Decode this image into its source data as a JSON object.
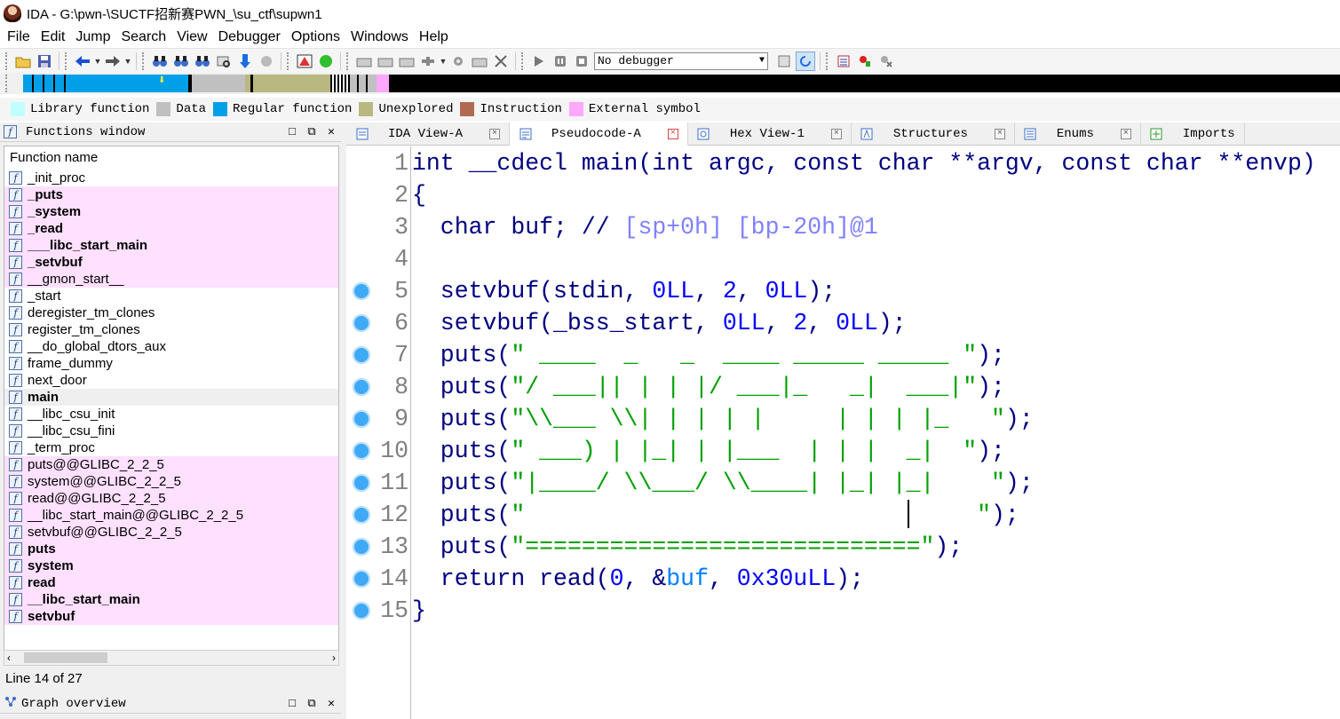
{
  "window": {
    "title": "IDA - G:\\pwn-\\SUCTF招新赛PWN_\\su_ctf\\supwn1"
  },
  "menu": [
    "File",
    "Edit",
    "Jump",
    "Search",
    "View",
    "Debugger",
    "Options",
    "Windows",
    "Help"
  ],
  "toolbar": {
    "debugger_select": "No debugger"
  },
  "legend": [
    {
      "label": "Library function",
      "color": "#c0ffff"
    },
    {
      "label": "Data",
      "color": "#c0c0c0"
    },
    {
      "label": "Regular function",
      "color": "#00a0e8"
    },
    {
      "label": "Unexplored",
      "color": "#b8b880"
    },
    {
      "label": "Instruction",
      "color": "#b06a50"
    },
    {
      "label": "External symbol",
      "color": "#ffa8ff"
    }
  ],
  "functions_window": {
    "title": "Functions window",
    "column_header": "Function name",
    "items": [
      {
        "name": "_init_proc",
        "style": "normal"
      },
      {
        "name": "_puts",
        "style": "lib-bold"
      },
      {
        "name": "_system",
        "style": "lib-bold"
      },
      {
        "name": "_read",
        "style": "lib-bold"
      },
      {
        "name": "___libc_start_main",
        "style": "lib-bold"
      },
      {
        "name": "_setvbuf",
        "style": "lib-bold"
      },
      {
        "name": "__gmon_start__",
        "style": "lib"
      },
      {
        "name": "_start",
        "style": "normal"
      },
      {
        "name": "deregister_tm_clones",
        "style": "normal"
      },
      {
        "name": "register_tm_clones",
        "style": "normal"
      },
      {
        "name": "__do_global_dtors_aux",
        "style": "normal"
      },
      {
        "name": "frame_dummy",
        "style": "normal"
      },
      {
        "name": "next_door",
        "style": "normal"
      },
      {
        "name": "main",
        "style": "selected-bold"
      },
      {
        "name": "__libc_csu_init",
        "style": "normal"
      },
      {
        "name": "__libc_csu_fini",
        "style": "normal"
      },
      {
        "name": "_term_proc",
        "style": "normal"
      },
      {
        "name": "puts@@GLIBC_2_2_5",
        "style": "lib"
      },
      {
        "name": "system@@GLIBC_2_2_5",
        "style": "lib"
      },
      {
        "name": "read@@GLIBC_2_2_5",
        "style": "lib"
      },
      {
        "name": "__libc_start_main@@GLIBC_2_2_5",
        "style": "lib"
      },
      {
        "name": "setvbuf@@GLIBC_2_2_5",
        "style": "lib"
      },
      {
        "name": "puts",
        "style": "lib-bold"
      },
      {
        "name": "system",
        "style": "lib-bold"
      },
      {
        "name": "read",
        "style": "lib-bold"
      },
      {
        "name": "__libc_start_main",
        "style": "lib-bold"
      },
      {
        "name": "setvbuf",
        "style": "lib-bold"
      }
    ],
    "status": "Line 14 of 27"
  },
  "graph_overview": {
    "title": "Graph overview"
  },
  "tabs": [
    {
      "label": "IDA View-A",
      "active": false
    },
    {
      "label": "Pseudocode-A",
      "active": true
    },
    {
      "label": "Hex View-1",
      "active": false
    },
    {
      "label": "Structures",
      "active": false
    },
    {
      "label": "Enums",
      "active": false
    },
    {
      "label": "Imports",
      "active": false
    }
  ],
  "code": {
    "lines": [
      {
        "n": "1",
        "bp": false,
        "parts": [
          [
            "",
            "int __cdecl main(int argc, const char **argv, const char **envp)"
          ]
        ]
      },
      {
        "n": "2",
        "bp": false,
        "parts": [
          [
            "",
            "{"
          ]
        ]
      },
      {
        "n": "3",
        "bp": false,
        "parts": [
          [
            "",
            "  char buf; // "
          ],
          [
            "cm",
            "[sp+0h] [bp-20h]@1"
          ]
        ]
      },
      {
        "n": "4",
        "bp": false,
        "parts": []
      },
      {
        "n": "5",
        "bp": true,
        "parts": [
          [
            "",
            "  setvbuf(stdin, "
          ],
          [
            "c",
            "0LL"
          ],
          [
            "",
            ", "
          ],
          [
            "c",
            "2"
          ],
          [
            "",
            ", "
          ],
          [
            "c",
            "0LL"
          ],
          [
            "",
            ");"
          ]
        ]
      },
      {
        "n": "6",
        "bp": true,
        "parts": [
          [
            "",
            "  setvbuf(_bss_start, "
          ],
          [
            "c",
            "0LL"
          ],
          [
            "",
            ", "
          ],
          [
            "c",
            "2"
          ],
          [
            "",
            ", "
          ],
          [
            "c",
            "0LL"
          ],
          [
            "",
            ");"
          ]
        ]
      },
      {
        "n": "7",
        "bp": true,
        "parts": [
          [
            "",
            "  puts("
          ],
          [
            "g",
            "\" ____  _   _  ____ _____ _____ \""
          ],
          [
            "",
            ");"
          ]
        ]
      },
      {
        "n": "8",
        "bp": true,
        "parts": [
          [
            "",
            "  puts("
          ],
          [
            "g",
            "\"/ ___|| | | |/ ___|_   _|  ___|\""
          ],
          [
            "",
            ");"
          ]
        ]
      },
      {
        "n": "9",
        "bp": true,
        "parts": [
          [
            "",
            "  puts("
          ],
          [
            "g",
            "\"\\\\___ \\\\| | | | |     | | | |_   \""
          ],
          [
            "",
            ");"
          ]
        ]
      },
      {
        "n": "10",
        "bp": true,
        "parts": [
          [
            "",
            "  puts("
          ],
          [
            "g",
            "\" ___) | |_| | |___  | | |  _|  \""
          ],
          [
            "",
            ");"
          ]
        ]
      },
      {
        "n": "11",
        "bp": true,
        "parts": [
          [
            "",
            "  puts("
          ],
          [
            "g",
            "\"|____/ \\\\___/ \\\\____| |_| |_|    \""
          ],
          [
            "",
            ");"
          ]
        ]
      },
      {
        "n": "12",
        "bp": true,
        "parts": [
          [
            "",
            "  puts("
          ],
          [
            "g",
            "\"                                \""
          ],
          [
            "",
            ");"
          ]
        ]
      },
      {
        "n": "13",
        "bp": true,
        "parts": [
          [
            "",
            "  puts("
          ],
          [
            "g",
            "\"============================\""
          ],
          [
            "",
            ");"
          ]
        ]
      },
      {
        "n": "14",
        "bp": true,
        "parts": [
          [
            "",
            "  return read("
          ],
          [
            "c",
            "0"
          ],
          [
            "",
            ", &"
          ],
          [
            "v",
            "buf"
          ],
          [
            "",
            ", "
          ],
          [
            "c",
            "0x30uLL"
          ],
          [
            "",
            ");"
          ]
        ]
      },
      {
        "n": "15",
        "bp": true,
        "parts": [
          [
            "",
            "}"
          ]
        ]
      }
    ]
  }
}
